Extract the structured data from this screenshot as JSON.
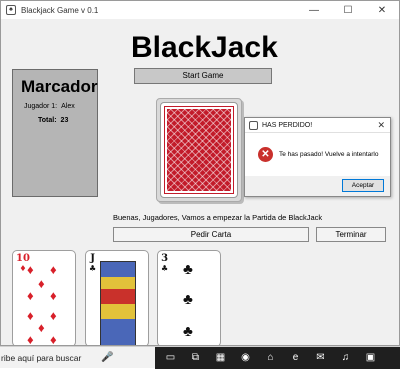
{
  "window": {
    "title": "Blackjack Game v 0.1",
    "icon": "app-icon",
    "controls": [
      "—",
      "☐",
      "✕"
    ]
  },
  "main": {
    "title": "BlackJack",
    "start_button": "Start Game",
    "status_message": "Buenas, Jugadores, Vamos a empezar la Partida de BlackJack",
    "pedir_button": "Pedir Carta",
    "terminar_button": "Terminar"
  },
  "marcador": {
    "title": "Marcador",
    "player_label": "Jugador 1:",
    "player_name": "Alex",
    "total_label": "Total:",
    "total_value": "23"
  },
  "dialog": {
    "title": "HAS PERDIDO!",
    "message": "Te has pasado! Vuelve a intentarlo",
    "ok_button": "Aceptar",
    "close": "✕",
    "error_icon": "✕"
  },
  "cards": [
    {
      "rank": "10",
      "suit": "♦",
      "color": "#d8202a"
    },
    {
      "rank": "J",
      "suit": "♣",
      "color": "#111111"
    },
    {
      "rank": "3",
      "suit": "♣",
      "color": "#111111"
    }
  ],
  "taskbar": {
    "search_text": "ribe aquí para buscar",
    "mic": "🎤",
    "items": [
      "▭",
      "⧉",
      "▦",
      "◉",
      "⌂",
      "e",
      "✉",
      "♫",
      "▣"
    ]
  },
  "colors": {
    "card_back": "#c21b2a",
    "score_panel": "#b5b5b5",
    "error": "#c9302c",
    "taskbar_dark": "#1f1f1f"
  }
}
